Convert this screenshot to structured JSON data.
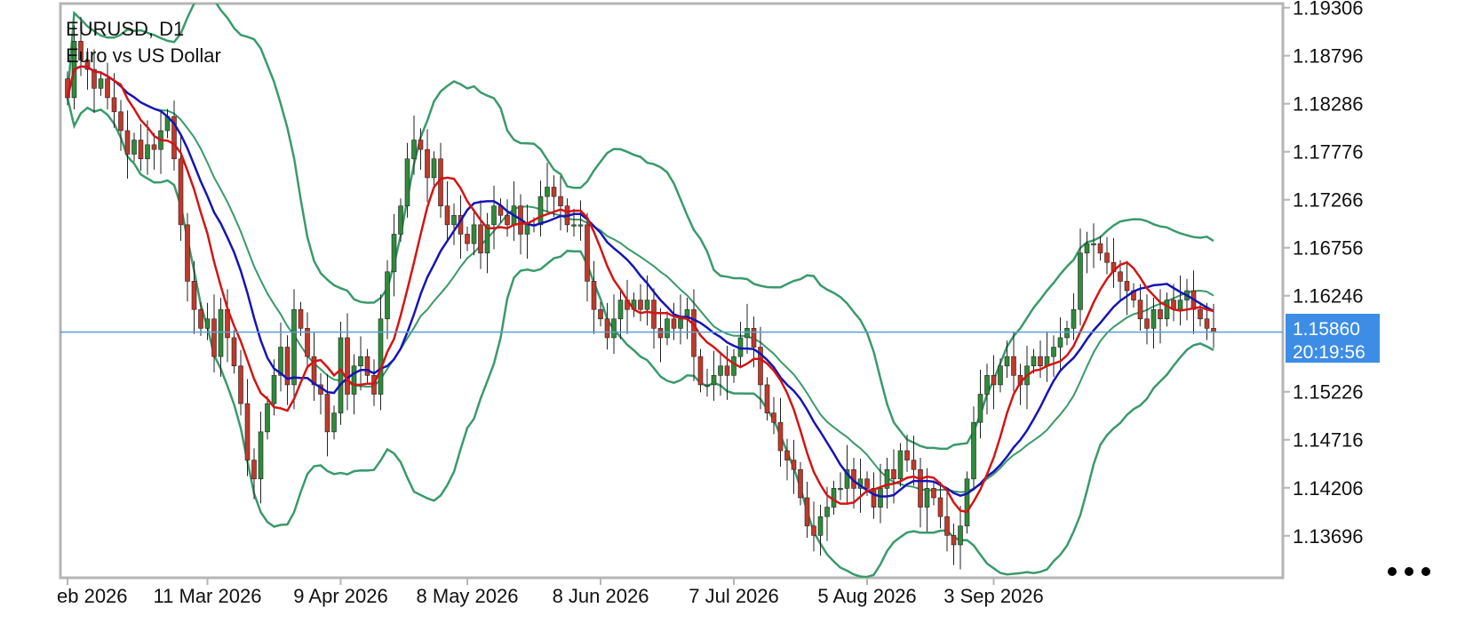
{
  "header": {
    "symbol": "EURUSD, D1",
    "description": "Euro vs US Dollar"
  },
  "current_price": {
    "value": "1.15860",
    "countdown": "20:19:56",
    "level": 1.1586
  },
  "colors": {
    "bull": "#2e8b3a",
    "bear": "#c0392b",
    "bollinger": "#3a9a6a",
    "ma_fast": "#d41414",
    "ma_slow": "#1515b5",
    "price_line": "#5aa0d0",
    "price_box": "#3d8de6",
    "frame": "#b5b5b5"
  },
  "menu": {
    "icon": "more-horizontal-icon"
  },
  "chart_data": {
    "type": "candlestick",
    "symbol": "EURUSD",
    "timeframe": "D1",
    "ylim": [
      1.1325,
      1.1935
    ],
    "y_ticks": [
      "1.19306",
      "1.18796",
      "1.18286",
      "1.17776",
      "1.17266",
      "1.16756",
      "1.16246",
      "1.15226",
      "1.14716",
      "1.14206",
      "1.13696"
    ],
    "x_ticks": [
      {
        "label": "eb 2026",
        "index": 0
      },
      {
        "label": "11 Mar 2026",
        "index": 21
      },
      {
        "label": "9 Apr 2026",
        "index": 41
      },
      {
        "label": "8 May 2026",
        "index": 60
      },
      {
        "label": "8 Jun 2026",
        "index": 80
      },
      {
        "label": "7 Jul 2026",
        "index": 100
      },
      {
        "label": "5 Aug 2026",
        "index": 120
      },
      {
        "label": "3 Sep 2026",
        "index": 139
      }
    ],
    "closes": [
      1.1835,
      1.1895,
      1.1875,
      1.1865,
      1.1845,
      1.1855,
      1.1835,
      1.182,
      1.18,
      1.1775,
      1.179,
      1.177,
      1.1785,
      1.178,
      1.18,
      1.1815,
      1.177,
      1.17,
      1.164,
      1.161,
      1.159,
      1.16,
      1.156,
      1.161,
      1.158,
      1.155,
      1.151,
      1.145,
      1.143,
      1.148,
      1.151,
      1.154,
      1.157,
      1.153,
      1.161,
      1.159,
      1.156,
      1.153,
      1.152,
      1.148,
      1.15,
      1.158,
      1.152,
      1.155,
      1.156,
      1.154,
      1.152,
      1.16,
      1.165,
      1.169,
      1.172,
      1.177,
      1.179,
      1.178,
      1.175,
      1.177,
      1.172,
      1.17,
      1.171,
      1.169,
      1.168,
      1.17,
      1.167,
      1.17,
      1.172,
      1.171,
      1.17,
      1.172,
      1.169,
      1.17,
      1.17,
      1.173,
      1.174,
      1.173,
      1.172,
      1.17,
      1.17,
      1.17,
      1.164,
      1.161,
      1.16,
      1.158,
      1.16,
      1.162,
      1.161,
      1.162,
      1.161,
      1.162,
      1.159,
      1.158,
      1.16,
      1.159,
      1.16,
      1.161,
      1.156,
      1.153,
      1.153,
      1.154,
      1.155,
      1.154,
      1.156,
      1.158,
      1.159,
      1.157,
      1.153,
      1.15,
      1.149,
      1.146,
      1.145,
      1.144,
      1.141,
      1.138,
      1.137,
      1.139,
      1.14,
      1.142,
      1.142,
      1.144,
      1.142,
      1.143,
      1.142,
      1.14,
      1.142,
      1.144,
      1.143,
      1.146,
      1.145,
      1.144,
      1.14,
      1.142,
      1.141,
      1.139,
      1.137,
      1.136,
      1.138,
      1.143,
      1.149,
      1.152,
      1.154,
      1.153,
      1.155,
      1.156,
      1.154,
      1.153,
      1.155,
      1.156,
      1.155,
      1.156,
      1.157,
      1.158,
      1.159,
      1.161,
      1.167,
      1.168,
      1.168,
      1.167,
      1.166,
      1.165,
      1.164,
      1.163,
      1.162,
      1.16,
      1.159,
      1.161,
      1.16,
      1.162,
      1.161,
      1.162,
      1.163,
      1.161,
      1.16,
      1.159,
      1.1586
    ],
    "series": [
      {
        "name": "",
        "role": "ma_fast",
        "period": 8
      },
      {
        "name": "",
        "role": "ma_slow",
        "period": 14
      },
      {
        "name": "",
        "role": "bollinger",
        "period": 20,
        "deviations": 2
      }
    ],
    "grid": false,
    "current_price": 1.1586
  }
}
